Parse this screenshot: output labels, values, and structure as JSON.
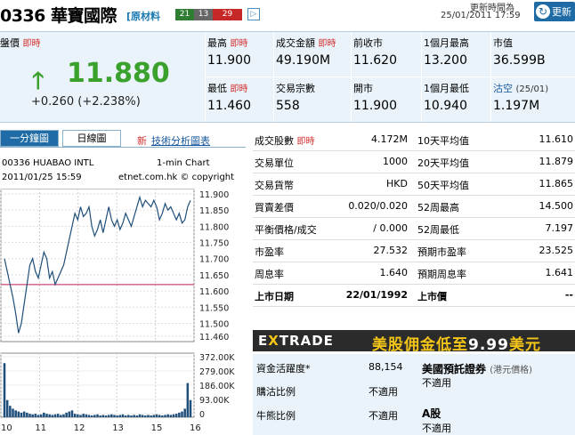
{
  "header": {
    "stock_code": "0336",
    "stock_name": "華寶國際",
    "category": "[原材料",
    "badges": [
      "21",
      "13",
      "29"
    ],
    "share_icon": "share-icon",
    "update_label": "更新時間為",
    "update_time": "25/01/2011 17:59",
    "refresh_label": "更新"
  },
  "quote": {
    "last_label": "盤價",
    "realtime": "即時",
    "price": "11.880",
    "change": "+0.260 (+2.238%)",
    "colors": {
      "up": "#3aa12d",
      "realtime": "#d32f2f"
    },
    "cells": [
      {
        "label": "最高",
        "rt": "即時",
        "value": "11.900"
      },
      {
        "label": "成交金額",
        "rt": "即時",
        "value": "49.190M"
      },
      {
        "label": "前收市",
        "rt": "",
        "value": "11.620"
      },
      {
        "label": "1個月最高",
        "rt": "",
        "value": "13.200"
      },
      {
        "label": "市值",
        "rt": "",
        "value": "36.599B"
      },
      {
        "label": "最低",
        "rt": "即時",
        "value": "11.460"
      },
      {
        "label": "交易宗數",
        "rt": "",
        "value": "558"
      },
      {
        "label": "開市",
        "rt": "",
        "value": "11.900"
      },
      {
        "label": "1個月最低",
        "rt": "",
        "value": "10.940"
      },
      {
        "label": "沽空",
        "rt": "(25/01)",
        "value": "1.197M"
      }
    ]
  },
  "chart_panel": {
    "tab_active": "一分鐘圖",
    "tab_daily": "日線圖",
    "new_label": "新",
    "analysis_link": "技術分析圖表",
    "line1_left": "00336 HUABAO INTL",
    "line1_right": "1-min Chart",
    "line2_left": "2011/01/25 15:59",
    "line2_right": "etnet.com.hk © copyright"
  },
  "chart_data": {
    "type": "line",
    "title": "",
    "x_ticks": [
      "10",
      "11",
      "12",
      "13",
      "15",
      "16"
    ],
    "price_ticks": [
      "11.900",
      "11.850",
      "11.800",
      "11.750",
      "11.700",
      "11.650",
      "11.600",
      "11.550",
      "11.500",
      "11.460"
    ],
    "volume_ticks": [
      "372.00K",
      "279.00K",
      "186.00K",
      "93.00K",
      "0"
    ],
    "ylim": [
      11.46,
      11.9
    ],
    "reference_line": 11.62,
    "series": [
      {
        "values": [
          11.7,
          11.66,
          11.62,
          11.58,
          11.53,
          11.47,
          11.5,
          11.56,
          11.62,
          11.68,
          11.7,
          11.66,
          11.64,
          11.68,
          11.72,
          11.7,
          11.64,
          11.66,
          11.62,
          11.64,
          11.66,
          11.68,
          11.72,
          11.76,
          11.8,
          11.84,
          11.82,
          11.86,
          11.83,
          11.84,
          11.86,
          11.8,
          11.77,
          11.79,
          11.82,
          11.78,
          11.82,
          11.86,
          11.82,
          11.8,
          11.82,
          11.79,
          11.81,
          11.84,
          11.82,
          11.8,
          11.83,
          11.86,
          11.89,
          11.86,
          11.88,
          11.87,
          11.86,
          11.88,
          11.86,
          11.82,
          11.84,
          11.87,
          11.85,
          11.86,
          11.84,
          11.82,
          11.84,
          11.81,
          11.82,
          11.86,
          11.88
        ]
      }
    ],
    "volume": [
      0.95,
      0.3,
      0.2,
      0.15,
      0.12,
      0.1,
      0.08,
      0.1,
      0.08,
      0.06,
      0.05,
      0.06,
      0.04,
      0.05,
      0.08,
      0.06,
      0.05,
      0.04,
      0.05,
      0.06,
      0.04,
      0.05,
      0.08,
      0.1,
      0.12,
      0.06,
      0.05,
      0.04,
      0.06,
      0.05,
      0.04,
      0.03,
      0.04,
      0.05,
      0.03,
      0.04,
      0.03,
      0.04,
      0.05,
      0.04,
      0.03,
      0.04,
      0.05,
      0.03,
      0.04,
      0.03,
      0.04,
      0.03,
      0.05,
      0.04,
      0.03,
      0.04,
      0.03,
      0.04,
      0.05,
      0.04,
      0.03,
      0.04,
      0.05,
      0.04,
      0.05,
      0.06,
      0.08,
      0.1,
      0.15,
      0.6,
      0.3
    ]
  },
  "stats": {
    "rows": [
      {
        "k1": "成交股數",
        "rt": "即時",
        "v1": "4.172M",
        "k2": "10天平均值",
        "v2": "11.610"
      },
      {
        "k1": "交易單位",
        "rt": "",
        "v1": "1000",
        "k2": "20天平均值",
        "v2": "11.879"
      },
      {
        "k1": "交易貨幣",
        "rt": "",
        "v1": "HKD",
        "k2": "50天平均值",
        "v2": "11.865"
      },
      {
        "k1": "買賣差價",
        "rt": "",
        "v1": "0.020/0.020",
        "k2": "52周最高",
        "v2": "14.500"
      },
      {
        "k1": "平衡價格/成交",
        "rt": "",
        "v1": "/ 0.000",
        "k2": "52周最低",
        "v2": "7.197"
      },
      {
        "k1": "市盈率",
        "rt": "",
        "v1": "27.532",
        "k2": "預期市盈率",
        "v2": "23.525"
      },
      {
        "k1": "周息率",
        "rt": "",
        "v1": "1.640",
        "k2": "預期周息率",
        "v2": "1.641"
      },
      {
        "k1": "上市日期",
        "rt": "",
        "v1": "22/01/1992",
        "k2": "上市價",
        "v2": "--"
      }
    ]
  },
  "ad": {
    "brand_pre": "E",
    "brand_x": "X",
    "brand_post": "TRADE",
    "promo_pre": "美股佣金低至",
    "promo_num": "9.99",
    "promo_post": "美元"
  },
  "lower": {
    "activity_label": "資金活躍度*",
    "activity_value": "88,154",
    "warrant_label": "美國預託證券",
    "warrant_sub": "(港元價格)",
    "warrant_value": "不適用",
    "call_label": "購沽比例",
    "call_value": "不適用",
    "bull_label": "牛熊比例",
    "bull_value": "不適用",
    "a_label": "A股",
    "a_value": "不適用"
  }
}
